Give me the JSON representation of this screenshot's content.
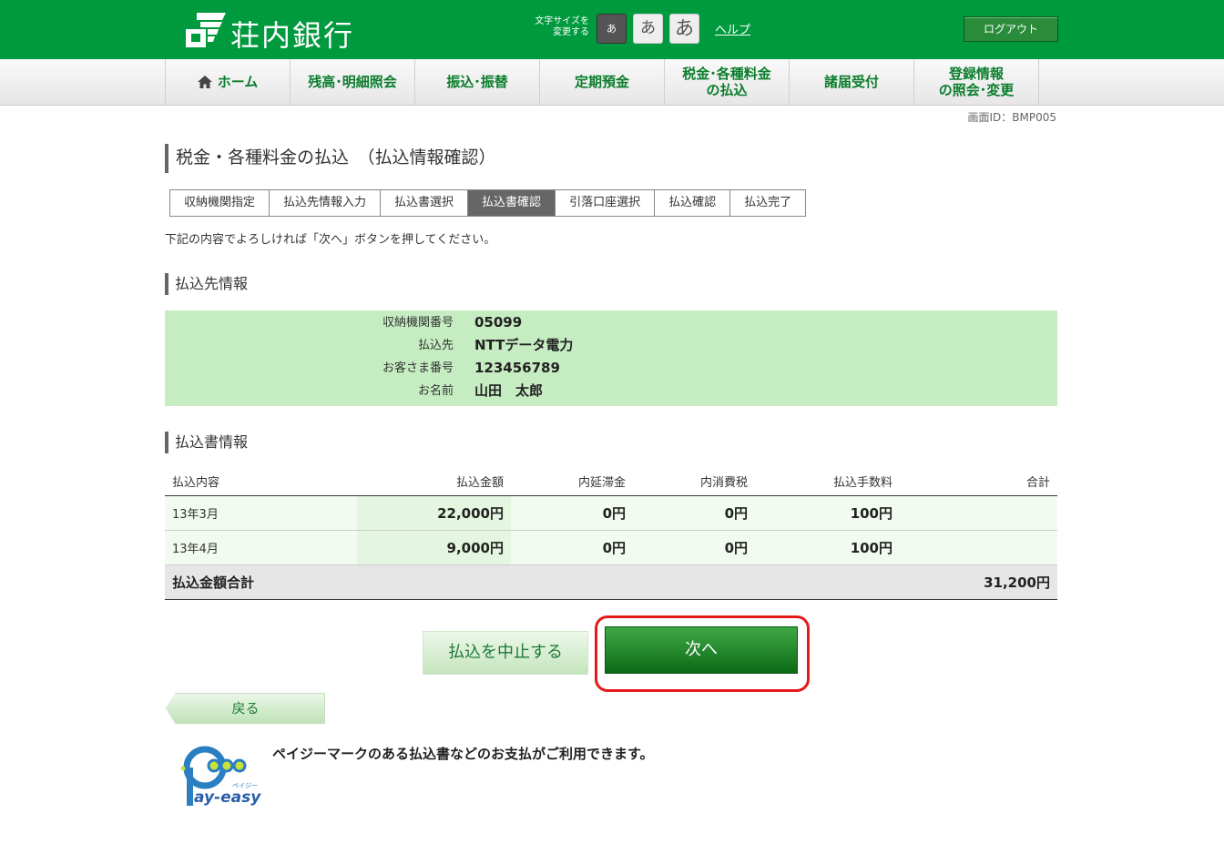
{
  "header": {
    "bank_name": "荘内銀行",
    "font_size_label_1": "文字サイズを",
    "font_size_label_2": "変更する",
    "font_size_small": "あ",
    "font_size_medium": "あ",
    "font_size_large": "あ",
    "help": "ヘルプ",
    "logout": "ログアウト"
  },
  "nav": [
    {
      "label": "ホーム"
    },
    {
      "label": "残高･明細照会"
    },
    {
      "label": "振込･振替"
    },
    {
      "label": "定期預金"
    },
    {
      "label_line1": "税金･各種料金",
      "label_line2": "の払込"
    },
    {
      "label": "諸届受付"
    },
    {
      "label_line1": "登録情報",
      "label_line2": "の照会･変更"
    }
  ],
  "screen_id": "画面ID：BMP005",
  "page_title": "税金・各種料金の払込　（払込情報確認）",
  "steps": [
    "収納機関指定",
    "払込先情報入力",
    "払込書選択",
    "払込書確認",
    "引落口座選択",
    "払込確認",
    "払込完了"
  ],
  "active_step": "払込書確認",
  "instruction": "下記の内容でよろしければ「次へ」ボタンを押してください。",
  "payee_section": {
    "title": "払込先情報",
    "rows": [
      {
        "label": "収納機関番号",
        "value": "05099"
      },
      {
        "label": "払込先",
        "value": "NTTデータ電力"
      },
      {
        "label": "お客さま番号",
        "value": "123456789"
      },
      {
        "label": "お名前",
        "value": "山田　太郎"
      }
    ]
  },
  "bill_section": {
    "title": "払込書情報",
    "headers": [
      "払込内容",
      "払込金額",
      "内延滞金",
      "内消費税",
      "払込手数料",
      "合計"
    ],
    "rows": [
      {
        "item": "13年3月",
        "amount": "22,000円",
        "late_fee": "0円",
        "tax": "0円",
        "fee": "100円",
        "total": ""
      },
      {
        "item": "13年4月",
        "amount": "9,000円",
        "late_fee": "0円",
        "tax": "0円",
        "fee": "100円",
        "total": ""
      }
    ],
    "total_label": "払込金額合計",
    "total_value": "31,200円"
  },
  "buttons": {
    "cancel": "払込を中止する",
    "next": "次へ",
    "back": "戻る"
  },
  "payeasy": {
    "message": "ペイジーマークのある払込書などのお支払がご利用できます。",
    "logo_text": "ay-easy",
    "logo_kana": "ペイジー"
  },
  "colors": {
    "brand_green": "#009a3e",
    "highlight_red": "#e21a1a",
    "payee_bg": "#c6edc2"
  }
}
